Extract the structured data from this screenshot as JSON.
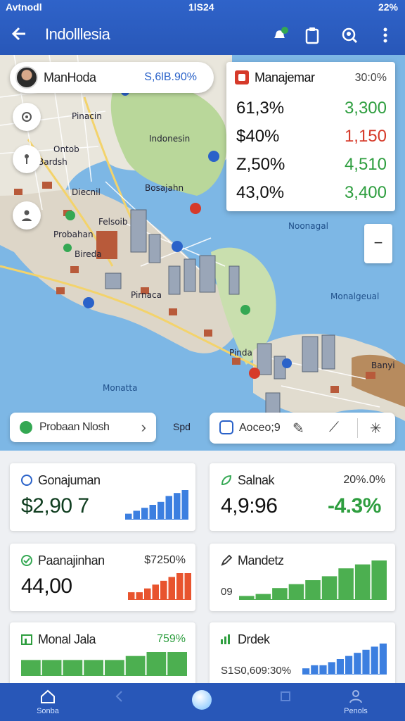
{
  "status_bar": {
    "carrier": "Avtnodl",
    "time": "1lS24",
    "battery": "22%"
  },
  "header": {
    "title": "Indolllesia"
  },
  "map": {
    "location_pill": {
      "name": "ManHoda",
      "value": "S,6lB.90%"
    },
    "stats_panel": {
      "title": "Manajemar",
      "percent": "30:0%",
      "rows": [
        {
          "label": "61,3%",
          "value": "3,300",
          "color": "#2e9e3f"
        },
        {
          "label": "$40%",
          "value": "1,150",
          "color": "#d63a2a"
        },
        {
          "label": "Z,50%",
          "value": "4,510",
          "color": "#2e9e3f"
        },
        {
          "label": "43,0%",
          "value": "3,400",
          "color": "#2e9e3f"
        }
      ]
    },
    "labels": {
      "pinacin": "Pinacin",
      "indonesia": "Indonesin",
      "ontob": "Ontob",
      "barah": "Bardsh",
      "diecnil": "Diecnil",
      "bosajahn": "Bosajahn",
      "felsoib": "Felsoib",
      "probahan": "Probahan",
      "bireda": "Bireda",
      "pirnaca": "Pirnaca",
      "monasgal": "Noonagal",
      "monajpual": "Monalgeual",
      "pinda": "Pinda",
      "monatta": "Monatta",
      "banyi": "Banyi"
    },
    "route_pill": {
      "label": "Probaan Nlosh"
    },
    "map_caption": "Spd",
    "toolbar": {
      "label": "Aoceo;9"
    }
  },
  "cards": [
    {
      "title": "Gonajuman",
      "right": "",
      "big": "$2,90 7",
      "chart": {
        "color": "#3c7fe0",
        "values": [
          2,
          3,
          4,
          5,
          6,
          8,
          9,
          10
        ]
      }
    },
    {
      "title": "Salnak",
      "right": "20%.0%",
      "big": "4,9:96",
      "accent": "-4.3%",
      "accent_color": "#2e9e3f"
    },
    {
      "title": "Paanajinhan",
      "right": "$7250%",
      "big": "44,00",
      "chart": {
        "color": "#e8542e",
        "values": [
          2,
          2,
          3,
          4,
          5,
          6,
          7,
          7
        ]
      }
    },
    {
      "title": "Mandetz",
      "right": "",
      "sub": "09",
      "chart": {
        "color": "#4caf50",
        "values": [
          1,
          1.5,
          3,
          4,
          5,
          6,
          8,
          9,
          10
        ]
      }
    },
    {
      "title": "Monal Jala",
      "right": "759%",
      "right_color": "#2e9e3f",
      "chart": {
        "color": "#4caf50",
        "values": [
          4,
          4,
          4,
          4,
          4,
          5,
          6,
          6
        ]
      }
    },
    {
      "title": "Drdek",
      "right": "",
      "sub": "S1S0,609:30%",
      "chart": {
        "color": "#3c7fe0",
        "values": [
          2,
          3,
          3,
          4,
          5,
          6,
          7,
          8,
          9,
          10
        ]
      }
    }
  ],
  "bottom_nav": {
    "left": "Sonba",
    "right": "Penols"
  }
}
